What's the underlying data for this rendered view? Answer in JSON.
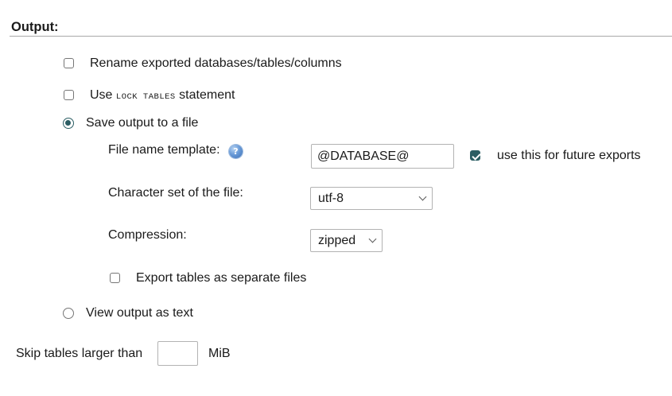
{
  "section": {
    "title": "Output:"
  },
  "options": {
    "rename_label": "Rename exported databases/tables/columns",
    "lock_prefix": "Use",
    "lock_keyword": "LOCK TABLES",
    "lock_suffix": "statement",
    "save_file_label": "Save output to a file",
    "view_text_label": "View output as text"
  },
  "file": {
    "name_template_label": "File name template:",
    "help_icon_glyph": "?",
    "name_template_value": "@DATABASE@",
    "future_exports_label": "use this for future exports",
    "charset_label": "Character set of the file:",
    "charset_value": "utf-8",
    "compression_label": "Compression:",
    "compression_value": "zipped",
    "separate_files_label": "Export tables as separate files"
  },
  "skip": {
    "label": "Skip tables larger than",
    "value": "",
    "unit": "MiB"
  },
  "state": {
    "rename_checked": false,
    "lock_tables_checked": false,
    "output_mode": "file",
    "future_exports_checked": true,
    "separate_files_checked": false
  },
  "colors": {
    "accent": "#2b5d63",
    "rule": "#a9a9a9",
    "input_border": "#b3b3b3"
  }
}
